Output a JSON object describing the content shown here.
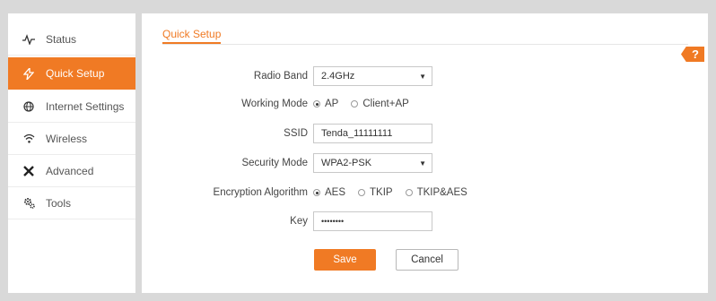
{
  "sidebar": {
    "items": [
      {
        "label": "Status",
        "icon": "pulse-icon"
      },
      {
        "label": "Quick Setup",
        "icon": "lightning-icon",
        "active": true
      },
      {
        "label": "Internet Settings",
        "icon": "globe-icon"
      },
      {
        "label": "Wireless",
        "icon": "wifi-icon"
      },
      {
        "label": "Advanced",
        "icon": "tools-icon"
      },
      {
        "label": "Tools",
        "icon": "gears-icon"
      }
    ]
  },
  "main": {
    "title": "Quick Setup",
    "help_label": "?",
    "form": {
      "radio_band": {
        "label": "Radio Band",
        "value": "2.4GHz"
      },
      "working_mode": {
        "label": "Working Mode",
        "options": [
          "AP",
          "Client+AP"
        ],
        "selected": "AP"
      },
      "ssid": {
        "label": "SSID",
        "value": "Tenda_11111111"
      },
      "security_mode": {
        "label": "Security Mode",
        "value": "WPA2-PSK"
      },
      "encryption": {
        "label": "Encryption Algorithm",
        "options": [
          "AES",
          "TKIP",
          "TKIP&AES"
        ],
        "selected": "AES"
      },
      "key": {
        "label": "Key",
        "value": "••••••••"
      }
    },
    "save_label": "Save",
    "cancel_label": "Cancel"
  },
  "colors": {
    "accent": "#f07a24",
    "background": "#d9d9d9"
  }
}
